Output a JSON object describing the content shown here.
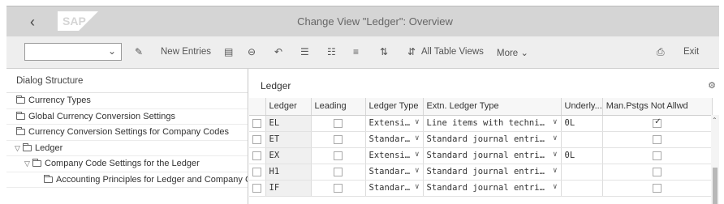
{
  "titlebar": {
    "title": "Change View \"Ledger\": Overview",
    "logo_text": "SAP",
    "back_icon": "chevron-left-icon"
  },
  "toolbar": {
    "select_value": "",
    "new_entries": "New Entries",
    "all_table_views": "All Table Views",
    "more": "More",
    "exit": "Exit"
  },
  "left": {
    "header": "Dialog Structure",
    "items": [
      {
        "label": "Currency Types"
      },
      {
        "label": "Global Currency Conversion Settings"
      },
      {
        "label": "Currency Conversion Settings for Company Codes"
      },
      {
        "label": "Ledger"
      },
      {
        "label": "Company Code Settings for the Ledger"
      },
      {
        "label": "Accounting Principles for Ledger and Company C"
      }
    ]
  },
  "right": {
    "header": "Ledger",
    "columns": [
      "Ledger",
      "Leading",
      "Ledger Type",
      "Extn. Ledger Type",
      "Underly...",
      "Man.Pstgs Not Allwd"
    ],
    "rows": [
      {
        "ledger": "EL",
        "ledger_type": "Extensi…",
        "extn": "Line items with techni…",
        "underly": "0L",
        "man_checked": true
      },
      {
        "ledger": "ET",
        "ledger_type": "Standar…",
        "extn": "Standard journal entri…",
        "underly": "",
        "man_checked": false
      },
      {
        "ledger": "EX",
        "ledger_type": "Extensi…",
        "extn": "Standard journal entri…",
        "underly": "0L",
        "man_checked": false
      },
      {
        "ledger": "H1",
        "ledger_type": "Standar…",
        "extn": "Standard journal entri…",
        "underly": "",
        "man_checked": false
      },
      {
        "ledger": "IF",
        "ledger_type": "Standar…",
        "extn": "Standard journal entri…",
        "underly": "",
        "man_checked": false
      }
    ]
  }
}
